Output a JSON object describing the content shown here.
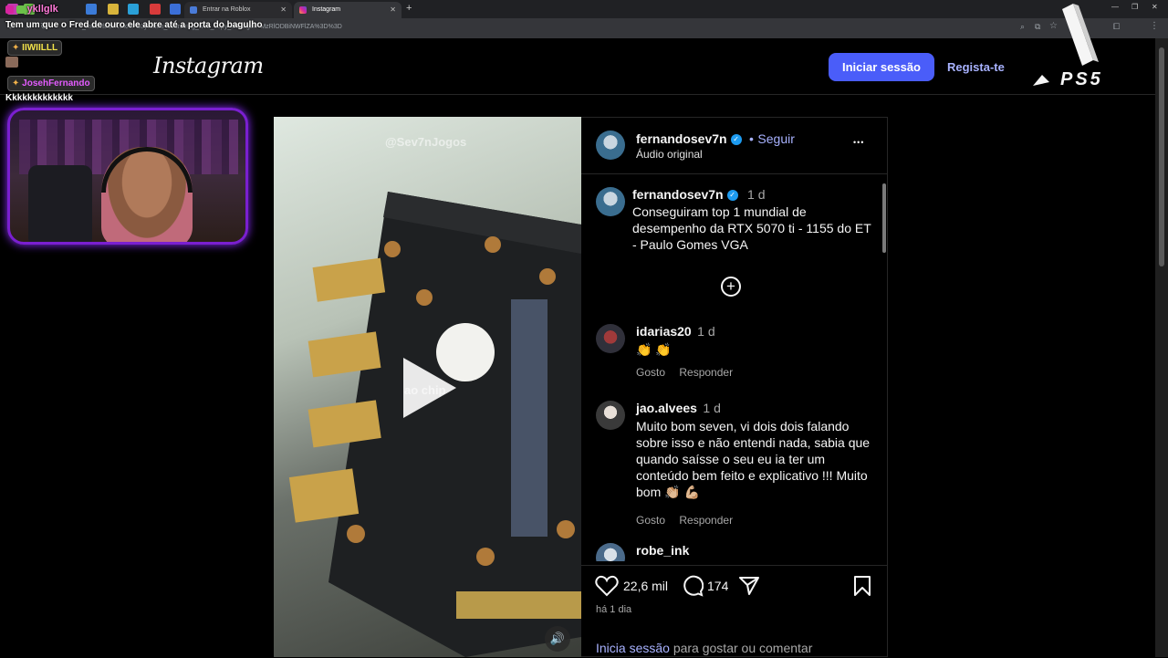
{
  "browser": {
    "tabs": [
      {
        "label": "Entrar na Roblox"
      },
      {
        "label": "Instagram"
      }
    ],
    "new_tab": "+",
    "url": "_mUovf8ucNUxNPO3yi&utm_source=ig_web_copy_link&igsh=MzRlODBiNWFlZA%3D%3D"
  },
  "stream": {
    "chat": [
      {
        "user": "ykllglk",
        "message": "Tem um que o Fred de ouro ele abre até a porta do bagulho"
      },
      {
        "user": "IIWIILLL",
        "message": ""
      },
      {
        "user": "JosehFernando",
        "message": "Kkkkkkkkkkkkk"
      }
    ],
    "brand": "PS5"
  },
  "instagram": {
    "logo": "Instagram",
    "login_button": "Iniciar sessão",
    "signup_link": "Regista-te",
    "watermark": "@Sev7nJogos",
    "video_caption_overlay": "ao chip",
    "post": {
      "username": "fernandosev7n",
      "follow": "Seguir",
      "follow_separator": "•",
      "audio": "Áudio original",
      "more": "•••",
      "caption_user": "fernandosev7n",
      "caption_time": "1 d",
      "caption_text": "Conseguiram top 1 mundial de desempenho da RTX 5070 ti - 1155 do ET - Paulo Gomes VGA",
      "comments": [
        {
          "user": "idarias20",
          "time": "1 d",
          "text": "👏 👏",
          "like": "Gosto",
          "reply": "Responder"
        },
        {
          "user": "jao.alvees",
          "time": "1 d",
          "text": "Muito bom seven, vi dois dois falando sobre isso e não entendi nada, sabia que quando saísse o seu eu ia ter um conteúdo bem feito e explicativo !!! Muito bom 👏🏼 💪🏼",
          "like": "Gosto",
          "reply": "Responder"
        },
        {
          "user": "robe_ink",
          "time": "",
          "text": "",
          "like": "",
          "reply": ""
        }
      ],
      "likes": "22,6 mil",
      "comments_count": "174",
      "posted": "há 1 dia",
      "login_prompt_link": "Inicia sessão",
      "login_prompt_rest": " para gostar ou comentar"
    }
  },
  "colors": {
    "accent": "#4a5df9",
    "link": "#a8b2ff",
    "verified": "#1d9bf0",
    "webcam_border": "#7a1fd0"
  }
}
